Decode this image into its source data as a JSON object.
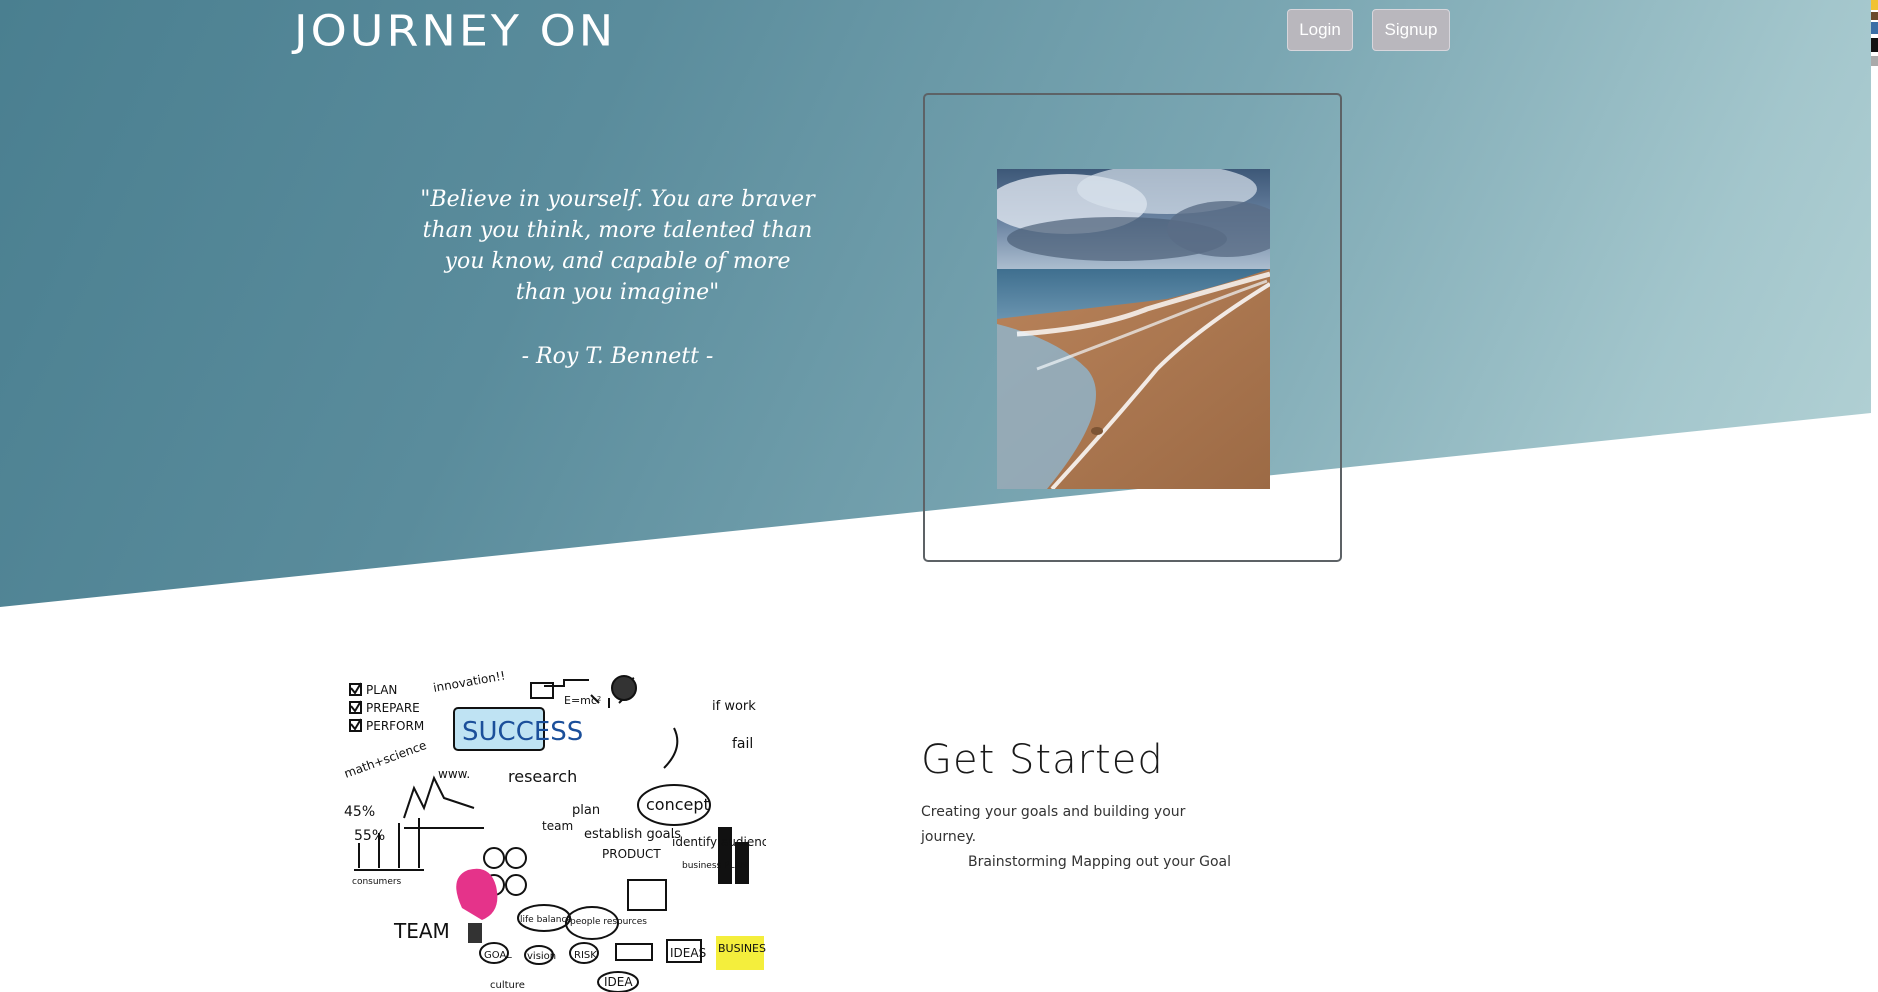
{
  "header": {
    "brand": "Journey on",
    "login_label": "Login",
    "signup_label": "Signup"
  },
  "hero": {
    "quote": "\"Believe in yourself. You are braver than you think, more talented than you know, and capable of more than you imagine\"",
    "author": "- Roy T. Bennett -"
  },
  "section": {
    "title": "Get Started",
    "line1": "Creating your goals and building your journey.",
    "line2": "Brainstorming Mapping out your Goal"
  },
  "colors": {
    "hero_start": "#4a7f90",
    "hero_end": "#b5d3d6",
    "button_bg": "#b9b7bd"
  },
  "sketch": {
    "words": [
      "PLAN",
      "PREPARE",
      "PERFORM",
      "innovation!!",
      "E=mc²",
      "SUCCESS",
      "if work",
      "fail",
      "math+science",
      "www.",
      "research",
      "concept",
      "45%",
      "55%",
      "plan",
      "team",
      "establish goals",
      "identify audiences!",
      "PRODUCT",
      "business PLAN",
      "consumers",
      "TEAM",
      "life balance",
      "people resources",
      "IDEAS",
      "BUSINESS PLAN",
      "GOAL",
      "vision",
      "RISK",
      "IDEA",
      "culture"
    ]
  }
}
